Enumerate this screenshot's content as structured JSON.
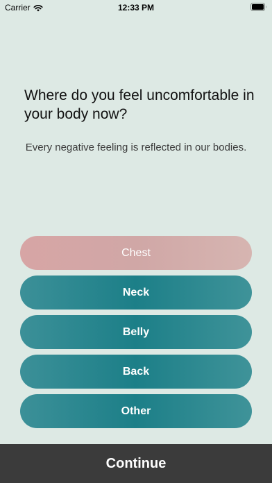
{
  "status_bar": {
    "carrier": "Carrier",
    "time": "12:33 PM",
    "icons": [
      "wifi-icon",
      "battery-icon"
    ]
  },
  "question": {
    "title": "Where do you feel uncomfortable in your body now?",
    "subtitle": "Every negative feeling is reflected in our bodies."
  },
  "options": [
    {
      "label": "Chest",
      "selected": true
    },
    {
      "label": "Neck",
      "selected": false
    },
    {
      "label": "Belly",
      "selected": false
    },
    {
      "label": "Back",
      "selected": false
    },
    {
      "label": "Other",
      "selected": false
    }
  ],
  "continue": {
    "label": "Continue"
  },
  "colors": {
    "background": "#dde9e4",
    "option_teal": "#1c7f88",
    "option_selected": "#d0a7a6",
    "continue_bar": "#3b3b3b"
  }
}
